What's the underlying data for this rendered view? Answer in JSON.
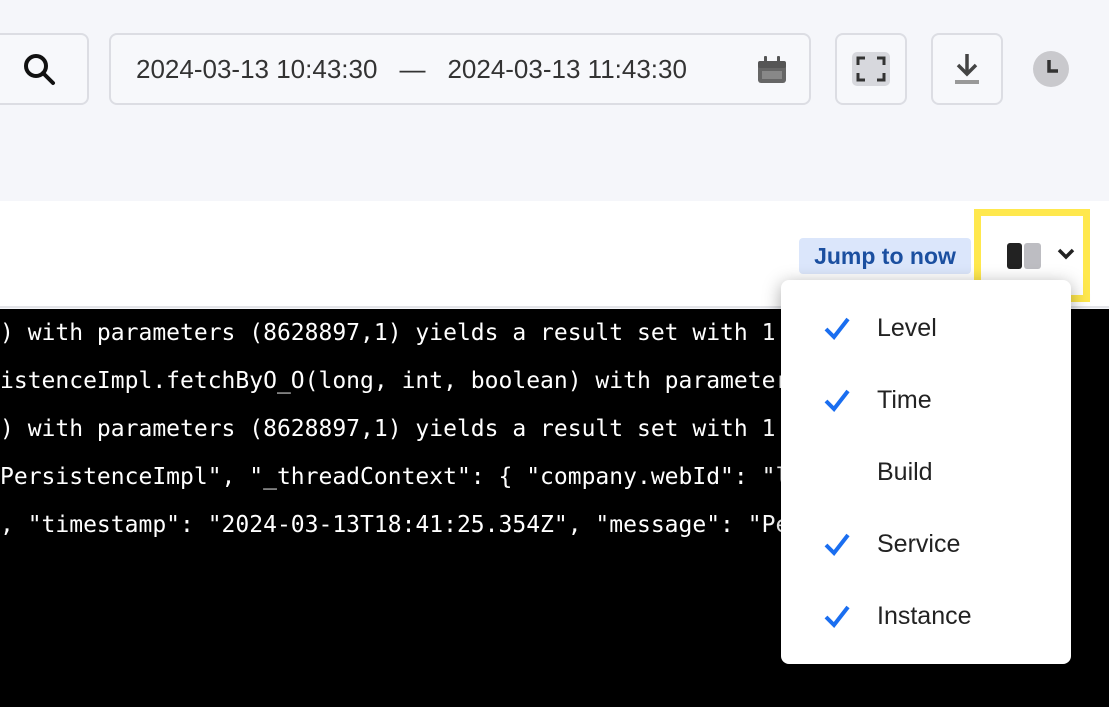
{
  "date_range": {
    "start": "2024-03-13 10:43:30",
    "separator": "—",
    "end": "2024-03-13 11:43:30"
  },
  "toolbar": {
    "jump_label": "Jump to now"
  },
  "log_lines": [
    ") with parameters (8628897,1) yields a result set with 1 resu",
    "istenceImpl.fetchByO_O(long, int, boolean) with parameters (8628897,1)",
    ") with parameters (8628897,1) yields a result set with 1 resu",
    "PersistenceImpl\", \"_threadContext\": { \"company.webId\": \"liferay.com\", \"action",
    ", \"timestamp\": \"2024-03-13T18:41:25.354Z\", \"message\": \"Persistence"
  ],
  "column_menu": {
    "items": [
      {
        "label": "Level",
        "checked": true
      },
      {
        "label": "Time",
        "checked": true
      },
      {
        "label": "Build",
        "checked": false
      },
      {
        "label": "Service",
        "checked": true
      },
      {
        "label": "Instance",
        "checked": true
      }
    ]
  },
  "icons": {
    "search": "search-icon",
    "calendar": "calendar-icon",
    "fullscreen": "fullscreen-icon",
    "download": "download-icon",
    "clock": "clock-icon",
    "columns": "columns-icon",
    "chevron": "chevron-down-icon",
    "check": "check-icon"
  },
  "colors": {
    "accent": "#1a6ef0",
    "highlight": "#ffe84d",
    "jump_bg": "#dbe6fb",
    "jump_text": "#1b4fa0"
  }
}
